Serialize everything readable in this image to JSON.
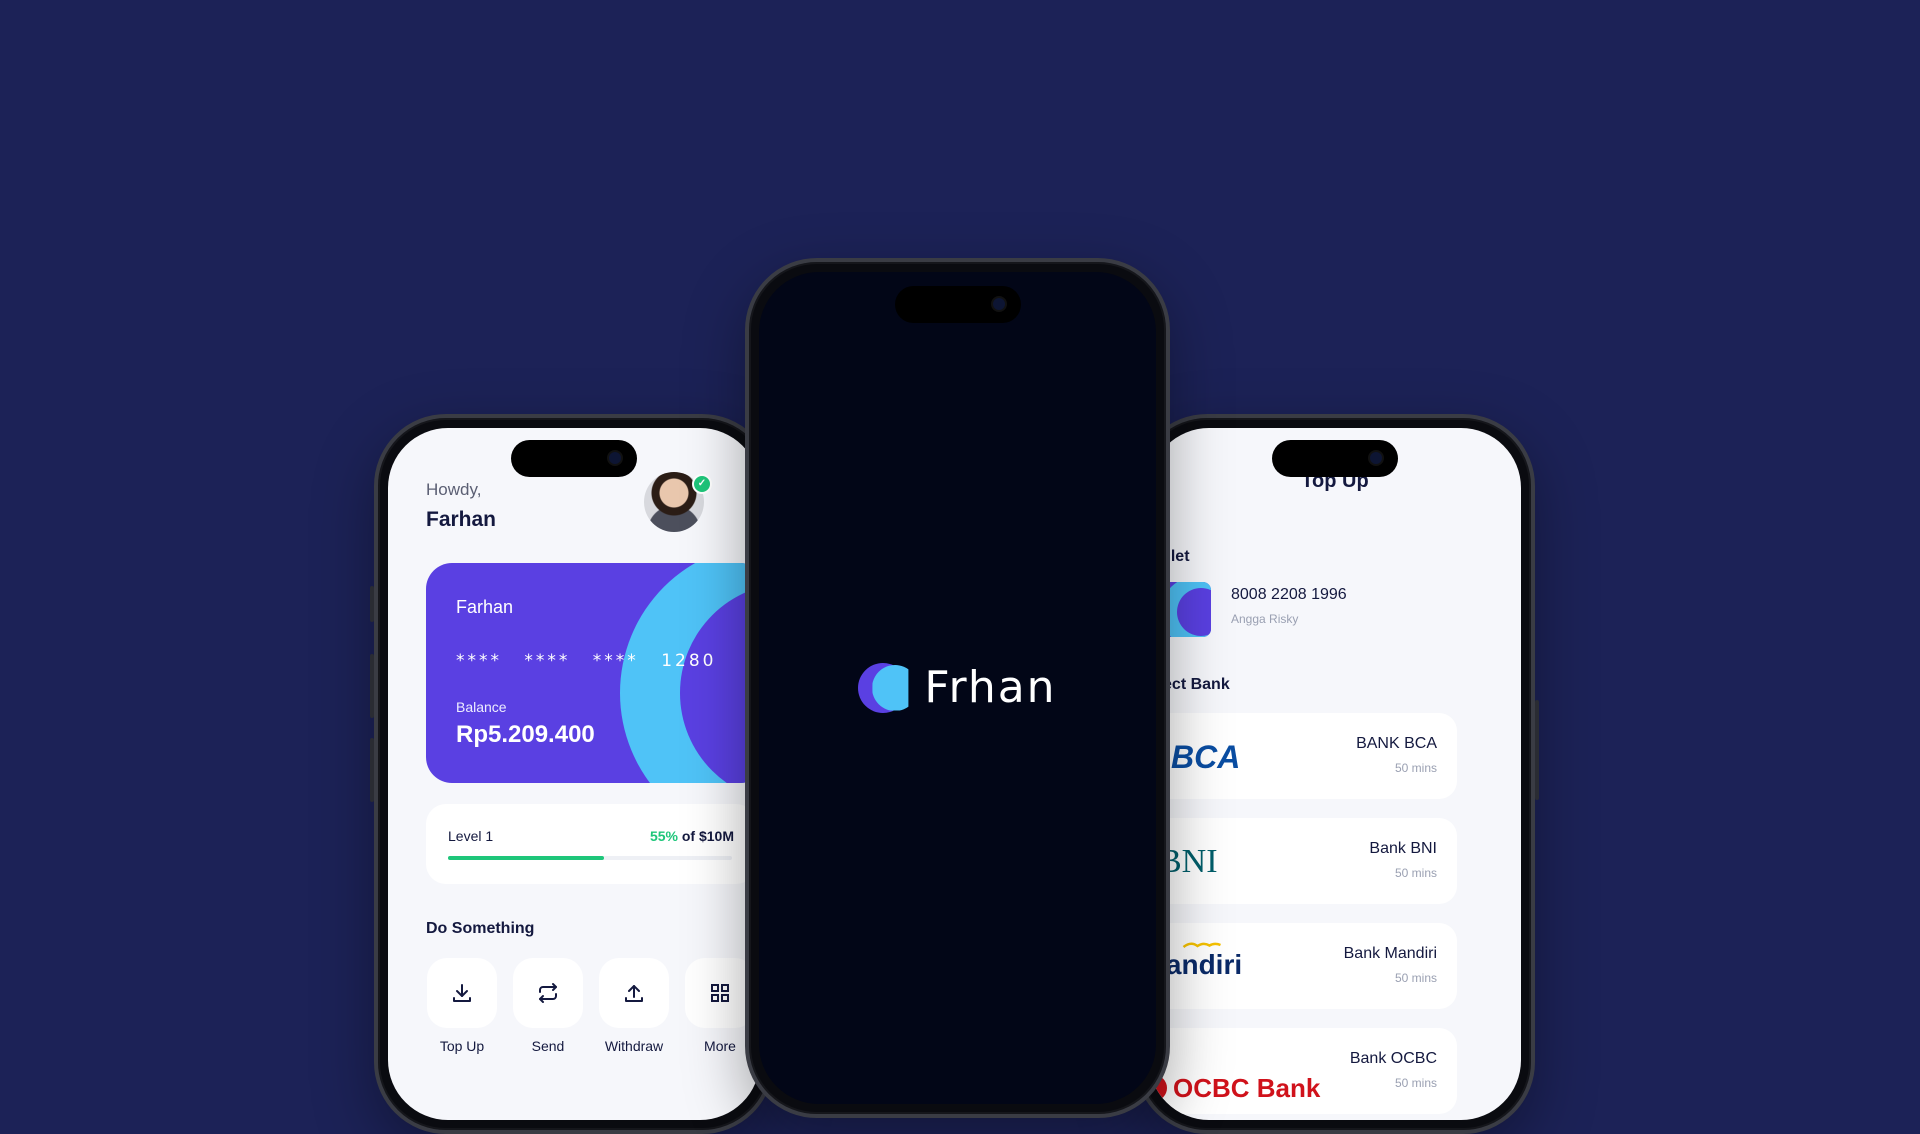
{
  "left_phone": {
    "greeting": "Howdy,",
    "user_name": "Farhan",
    "card": {
      "holder": "Farhan",
      "masked_number": "**** **** **** 1280",
      "balance_label": "Balance",
      "balance": "Rp5.209.400"
    },
    "level": {
      "label": "Level 1",
      "percent_text": "55%",
      "of_text": "of $10M",
      "progress": 0.55
    },
    "actions_title": "Do Something",
    "actions": [
      {
        "label": "Top Up",
        "icon": "download-icon"
      },
      {
        "label": "Send",
        "icon": "transfer-icon"
      },
      {
        "label": "Withdraw",
        "icon": "upload-icon"
      },
      {
        "label": "More",
        "icon": "grid-icon"
      }
    ]
  },
  "center_phone": {
    "logo_text": "Frhan"
  },
  "right_phone": {
    "title": "Top Up",
    "wallet_label": "Wallet",
    "wallet_number": "8008 2208 1996",
    "wallet_owner": "Angga Risky",
    "select_bank_label": "Select Bank",
    "banks": [
      {
        "name": "BANK BCA",
        "eta": "50 mins",
        "logo_text": "BCA"
      },
      {
        "name": "Bank BNI",
        "eta": "50 mins",
        "logo_text": "BNI"
      },
      {
        "name": "Bank Mandiri",
        "eta": "50 mins",
        "logo_text": "mandiri"
      },
      {
        "name": "Bank OCBC",
        "eta": "50 mins",
        "logo_text": "OCBC Bank"
      }
    ]
  },
  "colors": {
    "background": "#1c2257",
    "primary": "#5a40e2",
    "accent": "#4fc3f7",
    "success": "#1ec67a",
    "text_dark": "#14193f"
  }
}
